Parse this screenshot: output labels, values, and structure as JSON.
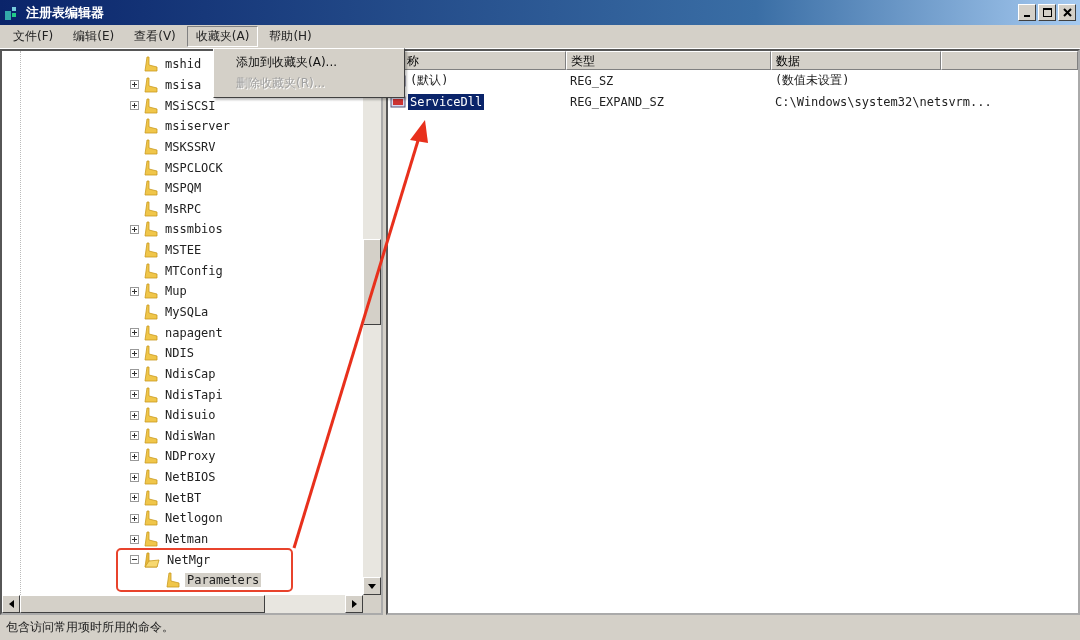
{
  "window": {
    "title": "注册表编辑器"
  },
  "menu": [
    {
      "label": "文件(F)",
      "selected": false
    },
    {
      "label": "编辑(E)",
      "selected": false
    },
    {
      "label": "查看(V)",
      "selected": false
    },
    {
      "label": "收藏夹(A)",
      "selected": true
    },
    {
      "label": "帮助(H)",
      "selected": false
    }
  ],
  "dropdown": [
    {
      "label": "添加到收藏夹(A)...",
      "disabled": false
    },
    {
      "label": "删除收藏夹(R)...",
      "disabled": true
    }
  ],
  "tree": [
    {
      "label": "mshid",
      "expandable": false,
      "expanded": false,
      "selected": false
    },
    {
      "label": "msisa",
      "expandable": true,
      "expanded": false,
      "selected": false
    },
    {
      "label": "MSiSCSI",
      "expandable": true,
      "expanded": false,
      "selected": false
    },
    {
      "label": "msiserver",
      "expandable": false,
      "expanded": false,
      "selected": false
    },
    {
      "label": "MSKSSRV",
      "expandable": false,
      "expanded": false,
      "selected": false
    },
    {
      "label": "MSPCLOCK",
      "expandable": false,
      "expanded": false,
      "selected": false
    },
    {
      "label": "MSPQM",
      "expandable": false,
      "expanded": false,
      "selected": false
    },
    {
      "label": "MsRPC",
      "expandable": false,
      "expanded": false,
      "selected": false
    },
    {
      "label": "mssmbios",
      "expandable": true,
      "expanded": false,
      "selected": false
    },
    {
      "label": "MSTEE",
      "expandable": false,
      "expanded": false,
      "selected": false
    },
    {
      "label": "MTConfig",
      "expandable": false,
      "expanded": false,
      "selected": false
    },
    {
      "label": "Mup",
      "expandable": true,
      "expanded": false,
      "selected": false
    },
    {
      "label": "MySQLa",
      "expandable": false,
      "expanded": false,
      "selected": false
    },
    {
      "label": "napagent",
      "expandable": true,
      "expanded": false,
      "selected": false
    },
    {
      "label": "NDIS",
      "expandable": true,
      "expanded": false,
      "selected": false
    },
    {
      "label": "NdisCap",
      "expandable": true,
      "expanded": false,
      "selected": false
    },
    {
      "label": "NdisTapi",
      "expandable": true,
      "expanded": false,
      "selected": false
    },
    {
      "label": "Ndisuio",
      "expandable": true,
      "expanded": false,
      "selected": false
    },
    {
      "label": "NdisWan",
      "expandable": true,
      "expanded": false,
      "selected": false
    },
    {
      "label": "NDProxy",
      "expandable": true,
      "expanded": false,
      "selected": false
    },
    {
      "label": "NetBIOS",
      "expandable": true,
      "expanded": false,
      "selected": false
    },
    {
      "label": "NetBT",
      "expandable": true,
      "expanded": false,
      "selected": false
    },
    {
      "label": "Netlogon",
      "expandable": true,
      "expanded": false,
      "selected": false
    },
    {
      "label": "Netman",
      "expandable": true,
      "expanded": false,
      "selected": false
    },
    {
      "label": "NetMgr",
      "expandable": true,
      "expanded": true,
      "selected": false,
      "children": [
        {
          "label": "Parameters",
          "expandable": false,
          "expanded": false,
          "selected": true
        }
      ]
    }
  ],
  "list": {
    "columns": [
      "称",
      "类型",
      "数据"
    ],
    "rows": [
      {
        "name": "(默认)",
        "type": "REG_SZ",
        "data": "(数值未设置)",
        "selected": false
      },
      {
        "name": "ServiceDll",
        "type": "REG_EXPAND_SZ",
        "data": "C:\\Windows\\system32\\netsvrm...",
        "selected": true
      }
    ]
  },
  "status_bar": "包含访问常用项时所用的命令。"
}
